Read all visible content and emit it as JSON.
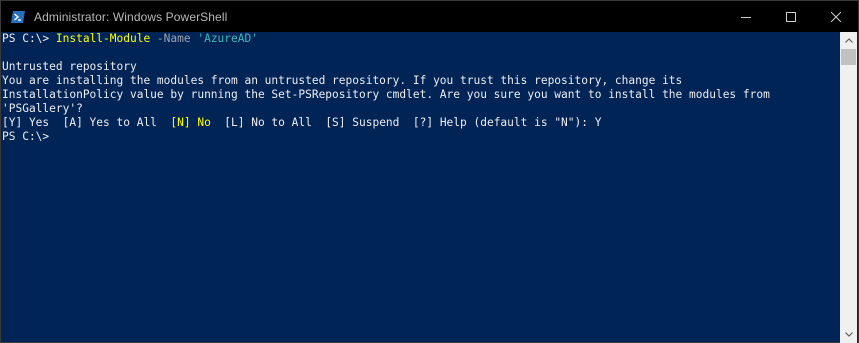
{
  "window": {
    "title": "Administrator: Windows PowerShell",
    "minimize_label": "minimize",
    "maximize_label": "maximize",
    "close_label": "close"
  },
  "console": {
    "line1": {
      "prompt": "PS C:\\> ",
      "command": "Install-Module",
      "param": " -Name ",
      "arg": "'AzureAD'"
    },
    "line2": "",
    "line3": "Untrusted repository",
    "line4": "You are installing the modules from an untrusted repository. If you trust this repository, change its",
    "line5": "InstallationPolicy value by running the Set-PSRepository cmdlet. Are you sure you want to install the modules from",
    "line6": "'PSGallery'?",
    "line7": {
      "part_a": "[Y] Yes  [A] Yes to All  ",
      "default_choice": "[N] No",
      "part_b": "  [L] No to All  [S] Suspend  [?] Help (default is \"N\"): Y"
    },
    "line8": "PS C:\\>"
  },
  "colors": {
    "background": "#012456",
    "text": "#eeedf0",
    "command": "#ffff00",
    "parameter": "#9aa3b0",
    "string": "#3fb6b6"
  },
  "icons": {
    "app": "powershell-icon",
    "minimize": "minimize-icon",
    "maximize": "maximize-icon",
    "close": "close-icon",
    "scroll_up": "arrow-up-icon",
    "scroll_down": "arrow-down-icon"
  }
}
